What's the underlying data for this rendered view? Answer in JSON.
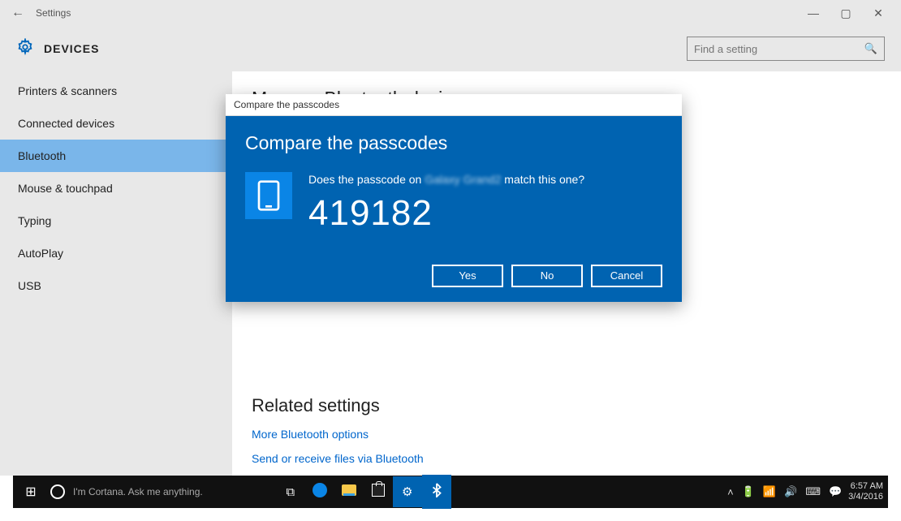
{
  "titlebar": {
    "title": "Settings"
  },
  "header": {
    "label": "DEVICES",
    "search_placeholder": "Find a setting"
  },
  "sidebar": {
    "items": [
      {
        "label": "Printers & scanners"
      },
      {
        "label": "Connected devices"
      },
      {
        "label": "Bluetooth"
      },
      {
        "label": "Mouse & touchpad"
      },
      {
        "label": "Typing"
      },
      {
        "label": "AutoPlay"
      },
      {
        "label": "USB"
      }
    ]
  },
  "main": {
    "heading": "Manage Bluetooth devices",
    "related_heading": "Related settings",
    "link_more": "More Bluetooth options",
    "link_send": "Send or receive files via Bluetooth"
  },
  "dialog": {
    "window_title": "Compare the passcodes",
    "heading": "Compare the passcodes",
    "prompt_prefix": "Does the passcode on ",
    "device_name": "Galaxy Grand2",
    "prompt_suffix": " match this one?",
    "passcode": "419182",
    "btn_yes": "Yes",
    "btn_no": "No",
    "btn_cancel": "Cancel"
  },
  "taskbar": {
    "cortana_text": "I'm Cortana. Ask me anything.",
    "time": "6:57 AM",
    "date": "3/4/2016"
  }
}
